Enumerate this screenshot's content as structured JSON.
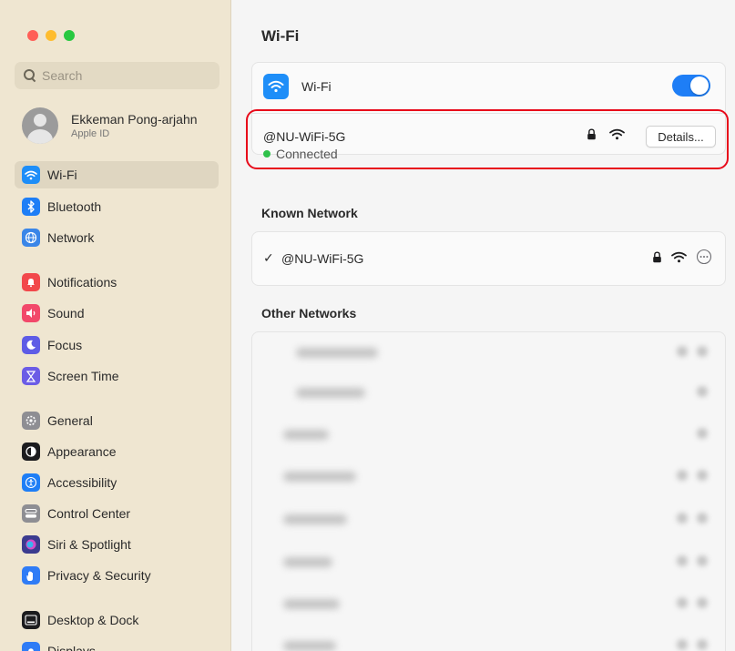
{
  "sidebar": {
    "search": {
      "placeholder": "Search"
    },
    "account": {
      "name": "Ekkeman Pong-arjahn",
      "subtitle": "Apple ID"
    },
    "items": [
      {
        "label": "Wi-Fi",
        "icon": "wifi-icon",
        "color": "#1e8ef8",
        "selected": true
      },
      {
        "label": "Bluetooth",
        "icon": "bluetooth-icon",
        "color": "#1e7ef6"
      },
      {
        "label": "Network",
        "icon": "globe-icon",
        "color": "#3a86e8"
      },
      {
        "label": "Notifications",
        "icon": "bell-icon",
        "color": "#f2484b"
      },
      {
        "label": "Sound",
        "icon": "speaker-icon",
        "color": "#f2486a"
      },
      {
        "label": "Focus",
        "icon": "moon-icon",
        "color": "#5e5ce6"
      },
      {
        "label": "Screen Time",
        "icon": "hourglass-icon",
        "color": "#6b5ce6"
      },
      {
        "label": "General",
        "icon": "gear-icon",
        "color": "#8e8e93"
      },
      {
        "label": "Appearance",
        "icon": "appearance-icon",
        "color": "#1c1c1e"
      },
      {
        "label": "Accessibility",
        "icon": "accessibility-icon",
        "color": "#1e7ef6"
      },
      {
        "label": "Control Center",
        "icon": "control-center-icon",
        "color": "#8e8e93"
      },
      {
        "label": "Siri & Spotlight",
        "icon": "siri-icon",
        "color": "#3b3b8f"
      },
      {
        "label": "Privacy & Security",
        "icon": "hand-icon",
        "color": "#2f7cf6"
      },
      {
        "label": "Desktop & Dock",
        "icon": "dock-icon",
        "color": "#1c1c1e"
      },
      {
        "label": "Displays",
        "icon": "display-icon",
        "color": "#2f7cf6"
      }
    ]
  },
  "main": {
    "title": "Wi-Fi",
    "wifi_toggle": {
      "label": "Wi-Fi",
      "on": true,
      "accent": "#1e7ef6"
    },
    "current": {
      "name": "@NU-WiFi-5G",
      "status": "Connected",
      "details_label": "Details...",
      "status_color": "#2fc14a"
    },
    "known_section": "Known Network",
    "known_network": {
      "name": "@NU-WiFi-5G",
      "check": "✓"
    },
    "other_section": "Other Networks"
  }
}
